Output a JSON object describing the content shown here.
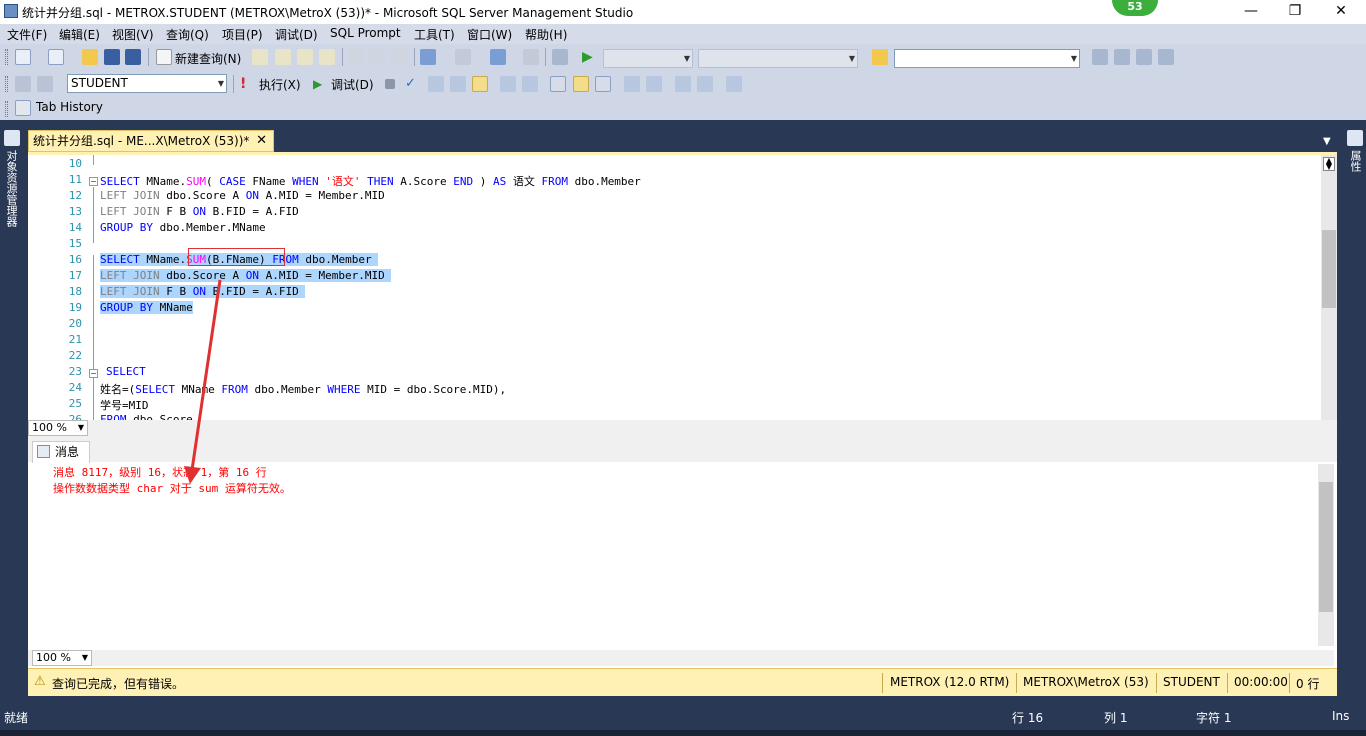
{
  "window": {
    "title": "统计并分组.sql - METROX.STUDENT (METROX\\MetroX (53))* - Microsoft SQL Server Management Studio",
    "badge": "53",
    "minimize": "—",
    "restore": "❐",
    "close": "✕"
  },
  "menu": [
    "文件(F)",
    "编辑(E)",
    "视图(V)",
    "查询(Q)",
    "项目(P)",
    "调试(D)",
    "SQL Prompt",
    "工具(T)",
    "窗口(W)",
    "帮助(H)"
  ],
  "toolbar1": {
    "new_query": "新建查询(N)"
  },
  "toolbar2": {
    "database": "STUDENT",
    "execute": "执行(X)",
    "debug": "调试(D)"
  },
  "toolbar3": {
    "tab_history": "Tab History"
  },
  "left_panel": "对象资源管理器",
  "right_panel": "属性",
  "doc_tab": {
    "label": "统计并分组.sql - ME...X\\MetroX (53))*",
    "close": "✕"
  },
  "editor": {
    "lines": [
      {
        "n": "10"
      },
      {
        "n": "11"
      },
      {
        "n": "12"
      },
      {
        "n": "13"
      },
      {
        "n": "14"
      },
      {
        "n": "15"
      },
      {
        "n": "16"
      },
      {
        "n": "17"
      },
      {
        "n": "18"
      },
      {
        "n": "19"
      },
      {
        "n": "20"
      },
      {
        "n": "21"
      },
      {
        "n": "22"
      },
      {
        "n": "23"
      },
      {
        "n": "24"
      },
      {
        "n": "25"
      },
      {
        "n": "26"
      }
    ],
    "code": {
      "l11": "SELECT MName.SUM( CASE FName WHEN '语文' THEN A.Score END ) AS 语文 FROM dbo.Member",
      "l12": "LEFT JOIN dbo.Score A ON A.MID = Member.MID",
      "l13": "LEFT JOIN F B ON B.FID = A.FID",
      "l14": "GROUP BY dbo.Member.MName",
      "l16": "SELECT MName.SUM(B.FName) FROM dbo.Member",
      "l17": "LEFT JOIN dbo.Score A ON A.MID = Member.MID",
      "l18": "LEFT JOIN F B ON B.FID = A.FID",
      "l19": "GROUP BY MName",
      "l23": " SELECT",
      "l24": "姓名=(SELECT MName FROM dbo.Member WHERE MID = dbo.Score.MID),",
      "l25": "学号=MID",
      "l26": "FROM dbo.Score"
    },
    "zoom": "100 %"
  },
  "results": {
    "tab": "消息",
    "messages": [
      "消息 8117，级别 16，状态 1，第 16 行",
      "操作数数据类型 char 对于 sum 运算符无效。"
    ],
    "zoom": "100 %"
  },
  "query_status": {
    "text": "查询已完成，但有错误。",
    "server": "METROX (12.0 RTM)",
    "user": "METROX\\MetroX (53)",
    "database": "STUDENT",
    "elapsed": "00:00:00",
    "rows": "0 行"
  },
  "app_status": {
    "ready": "就绪",
    "line": "行 16",
    "col": "列 1",
    "char": "字符 1",
    "mode": "Ins"
  },
  "colors": {
    "chrome": "#293955",
    "status_yellow": "#fff1b3",
    "keyword": "#0000ff",
    "function": "#ff00ff",
    "string": "#ff0000",
    "error_text": "#ff0000",
    "selection": "#add6ff"
  }
}
